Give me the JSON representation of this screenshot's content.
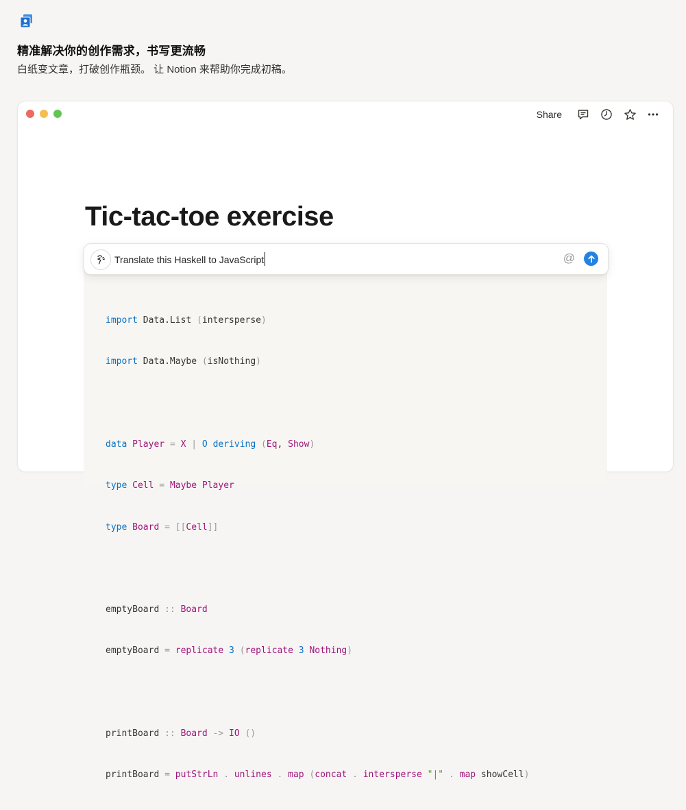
{
  "header": {
    "headline": "精准解决你的创作需求，书写更流畅",
    "subline": "白纸变文章，打破创作瓶颈。 让 Notion 来帮助你完成初稿。"
  },
  "window": {
    "toolbar": {
      "share_label": "Share"
    },
    "page_title": "Tic-tac-toe exercise",
    "ai_prompt": {
      "value": "Translate this Haskell to JavaScript",
      "at_symbol": "@"
    },
    "code_lines": [
      "import Data.List (intersperse)",
      "import Data.Maybe (isNothing)",
      "",
      "data Player = X | O deriving (Eq, Show)",
      "type Cell = Maybe Player",
      "type Board = [[Cell]]",
      "",
      "emptyBoard :: Board",
      "emptyBoard = replicate 3 (replicate 3 Nothing)",
      "",
      "printBoard :: Board -> IO ()",
      "printBoard = putStrLn . unlines . map (concat . intersperse \"|\" . map showCell)"
    ]
  },
  "colors": {
    "accent_blue": "#2383e2",
    "keyword": "#0b72c4",
    "type": "#a0147a",
    "background": "#f6f5f4"
  }
}
